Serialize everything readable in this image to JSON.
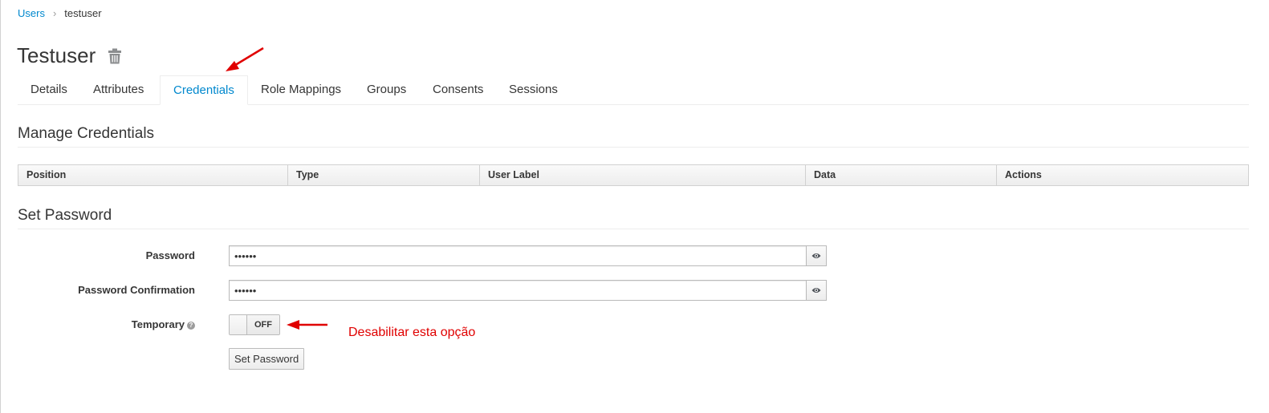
{
  "breadcrumb": {
    "parent": "Users",
    "separator": "›",
    "current": "testuser"
  },
  "page": {
    "title": "Testuser",
    "delete_icon": "trash-icon"
  },
  "tabs": [
    {
      "label": "Details"
    },
    {
      "label": "Attributes"
    },
    {
      "label": "Credentials",
      "active": true
    },
    {
      "label": "Role Mappings"
    },
    {
      "label": "Groups"
    },
    {
      "label": "Consents"
    },
    {
      "label": "Sessions"
    }
  ],
  "credentials": {
    "heading": "Manage Credentials",
    "columns": [
      "Position",
      "Type",
      "User Label",
      "Data",
      "Actions"
    ]
  },
  "set_password": {
    "heading": "Set Password",
    "password_label": "Password",
    "password_value": "••••••",
    "confirm_label": "Password Confirmation",
    "confirm_value": "••••••",
    "temporary_label": "Temporary",
    "temporary_state": "OFF",
    "submit_label": "Set Password"
  },
  "annotation": {
    "text": "Desabilitar esta opção",
    "color": "#e00000"
  },
  "colors": {
    "link": "#0088ce",
    "text": "#363636",
    "annotation": "#e00000"
  }
}
